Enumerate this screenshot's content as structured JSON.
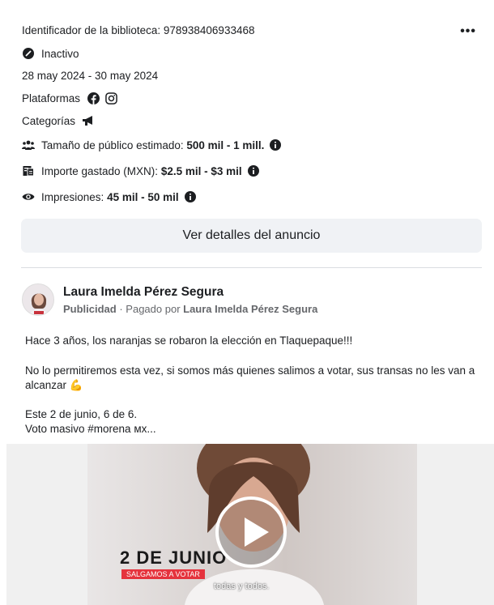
{
  "ad": {
    "library_id_label": "Identificador de la biblioteca: 978938406933468",
    "status": "Inactivo",
    "date_range": "28 may 2024 - 30 may 2024",
    "platforms_label": "Plataformas",
    "categories_label": "Categorías",
    "audience_label": "Tamaño de público estimado:",
    "audience_value": "500 mil - 1 mill.",
    "spend_label": "Importe gastado (MXN):",
    "spend_value": "$2.5 mil - $3 mil",
    "impressions_label": "Impresiones:",
    "impressions_value": "45 mil - 50 mil",
    "more_label": "•••",
    "details_button": "Ver detalles del anuncio"
  },
  "post": {
    "page_name": "Laura Imelda Pérez Segura",
    "sponsored_label": "Publicidad",
    "separator": " · ",
    "paid_by_label": "Pagado por ",
    "paid_by_name": "Laura Imelda Pérez Segura",
    "paragraph_1": "Hace 3 años, los naranjas se robaron la elección en Tlaquepaque!!!",
    "paragraph_2": "No lo permitiremos esta vez, si somos más quienes salimos a votar, sus transas no les van a alcanzar 💪",
    "paragraph_3a": "Este 2 de junio, 6 de 6.",
    "paragraph_3b": "Voto masivo #morena ᴍx..."
  },
  "video": {
    "title": "2 DE JUNIO",
    "subtitle": "SALGAMOS A VOTAR",
    "caption": "todas y todos."
  },
  "icons": {
    "status": "inactive-circle-icon",
    "platforms": [
      "facebook-icon",
      "instagram-icon"
    ],
    "category": "megaphone-icon",
    "audience": "people-icon",
    "spend": "receipt-icon",
    "impressions": "eye-icon",
    "info": "info-icon"
  }
}
